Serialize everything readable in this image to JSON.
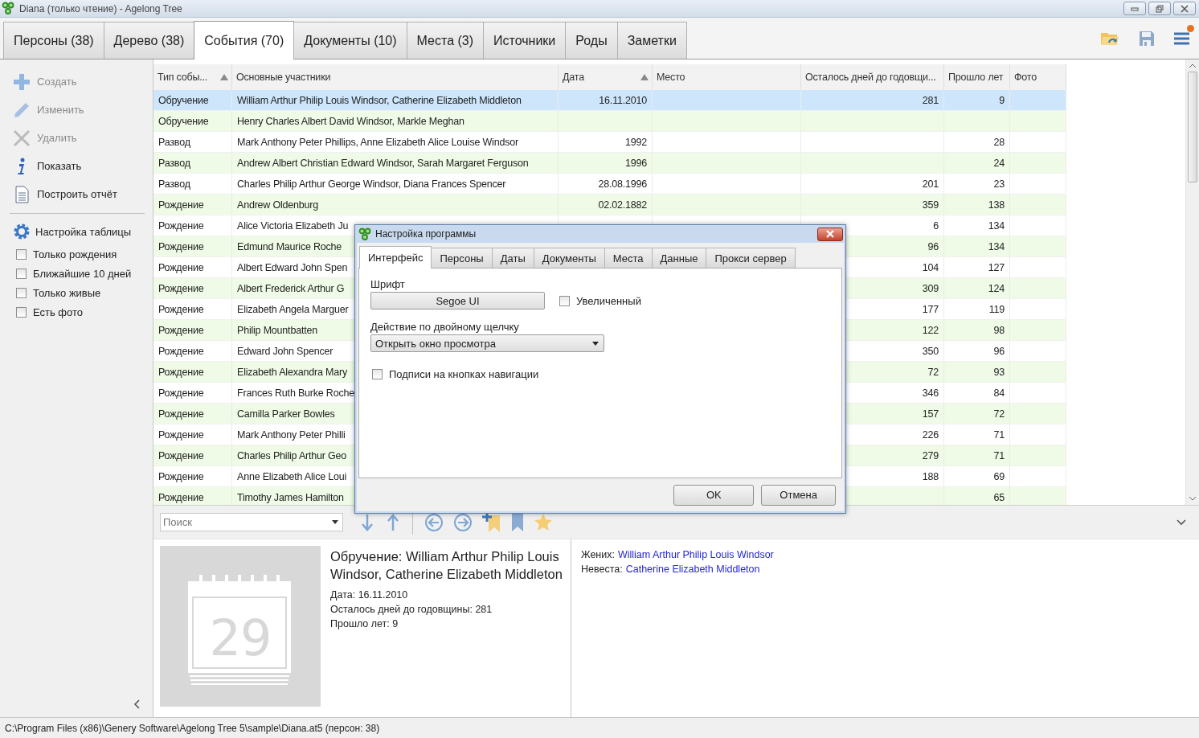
{
  "window": {
    "title": "Diana (только чтение) - Agelong Tree"
  },
  "tabs": [
    {
      "label": "Персоны (38)",
      "selected": false
    },
    {
      "label": "Дерево (38)",
      "selected": false
    },
    {
      "label": "События (70)",
      "selected": true
    },
    {
      "label": "Документы (10)",
      "selected": false
    },
    {
      "label": "Места (3)",
      "selected": false
    },
    {
      "label": "Источники",
      "selected": false
    },
    {
      "label": "Роды",
      "selected": false
    },
    {
      "label": "Заметки",
      "selected": false
    }
  ],
  "sidebar": {
    "actions": [
      {
        "label": "Создать",
        "disabled": true
      },
      {
        "label": "Изменить",
        "disabled": true
      },
      {
        "label": "Удалить",
        "disabled": true
      },
      {
        "label": "Показать",
        "disabled": false
      },
      {
        "label": "Построить отчёт",
        "disabled": false
      }
    ],
    "table_settings": "Настройка таблицы",
    "filters": [
      {
        "label": "Только рождения",
        "checked": false
      },
      {
        "label": "Ближайшие 10 дней",
        "checked": false
      },
      {
        "label": "Только живые",
        "checked": false
      },
      {
        "label": "Есть фото",
        "checked": false
      }
    ]
  },
  "table": {
    "columns": [
      {
        "label": "Тип собы...",
        "sorted": true
      },
      {
        "label": "Основные участники",
        "sorted": false
      },
      {
        "label": "Дата",
        "sorted": true
      },
      {
        "label": "Место",
        "sorted": false
      },
      {
        "label": "Осталось дней до годовщи...",
        "sorted": false
      },
      {
        "label": "Прошло лет",
        "sorted": false
      },
      {
        "label": "Фото",
        "sorted": false
      }
    ],
    "rows": [
      {
        "type": "Обручение",
        "participants": "William Arthur Philip Louis Windsor, Catherine Elizabeth Middleton",
        "date": "16.11.2010",
        "days_left": "281",
        "years": "9",
        "selected": true
      },
      {
        "type": "Обручение",
        "participants": "Henry Charles Albert David Windsor, Markle Meghan",
        "selected": false
      },
      {
        "type": "Развод",
        "participants": "Mark Anthony Peter Phillips, Anne Elizabeth Alice Louise Windsor",
        "date": "1992",
        "years": "28",
        "selected": false
      },
      {
        "type": "Развод",
        "participants": "Andrew Albert Christian Edward Windsor, Sarah Margaret Ferguson",
        "date": "1996",
        "years": "24",
        "selected": false
      },
      {
        "type": "Развод",
        "participants": "Charles Philip Arthur George Windsor, Diana Frances Spencer",
        "date": "28.08.1996",
        "days_left": "201",
        "years": "23",
        "selected": false
      },
      {
        "type": "Рождение",
        "participants": "Andrew Oldenburg",
        "date": "02.02.1882",
        "days_left": "359",
        "years": "138",
        "selected": false
      },
      {
        "type": "Рождение",
        "participants": "Alice Victoria Elizabeth Ju",
        "days_left": "6",
        "years": "134",
        "selected": false
      },
      {
        "type": "Рождение",
        "participants": "Edmund Maurice Roche",
        "days_left": "96",
        "years": "134",
        "selected": false
      },
      {
        "type": "Рождение",
        "participants": "Albert Edward John Spen",
        "days_left": "104",
        "years": "127",
        "selected": false
      },
      {
        "type": "Рождение",
        "participants": "Albert Frederick Arthur G",
        "days_left": "309",
        "years": "124",
        "selected": false
      },
      {
        "type": "Рождение",
        "participants": "Elizabeth Angela Marguer",
        "days_left": "177",
        "years": "119",
        "selected": false
      },
      {
        "type": "Рождение",
        "participants": "Philip Mountbatten",
        "days_left": "122",
        "years": "98",
        "selected": false
      },
      {
        "type": "Рождение",
        "participants": "Edward John Spencer",
        "days_left": "350",
        "years": "96",
        "selected": false
      },
      {
        "type": "Рождение",
        "participants": "Elizabeth Alexandra Mary",
        "days_left": "72",
        "years": "93",
        "selected": false
      },
      {
        "type": "Рождение",
        "participants": "Frances Ruth Burke Roche",
        "days_left": "346",
        "years": "84",
        "selected": false
      },
      {
        "type": "Рождение",
        "participants": "Camilla Parker Bowles",
        "days_left": "157",
        "years": "72",
        "selected": false
      },
      {
        "type": "Рождение",
        "participants": "Mark Anthony Peter Philli",
        "days_left": "226",
        "years": "71",
        "selected": false
      },
      {
        "type": "Рождение",
        "participants": "Charles Philip Arthur Geo",
        "days_left": "279",
        "years": "71",
        "selected": false
      },
      {
        "type": "Рождение",
        "participants": "Anne Elizabeth Alice Loui",
        "days_left": "188",
        "years": "69",
        "selected": false
      },
      {
        "type": "Рождение",
        "participants": "Timothy James Hamilton",
        "years": "65",
        "selected": false
      }
    ]
  },
  "toolbar": {
    "search": {
      "placeholder": "Поиск"
    }
  },
  "details": {
    "calendar_day": "29",
    "title": "Обручение: William Arthur Philip Louis Windsor, Catherine Elizabeth Middleton",
    "lines": [
      "Дата: 16.11.2010",
      "Осталось дней до годовщины: 281",
      "Прошло лет: 9"
    ],
    "relations": [
      {
        "label": "Жених:",
        "person": "William Arthur Philip Louis Windsor"
      },
      {
        "label": "Невеста:",
        "person": "Catherine Elizabeth Middleton"
      }
    ]
  },
  "status_bar": "C:\\Program Files (x86)\\Genery Software\\Agelong Tree 5\\sample\\Diana.at5 (персон: 38)",
  "dialog": {
    "title": "Настройка программы",
    "tabs": [
      {
        "label": "Интерфейс",
        "selected": true
      },
      {
        "label": "Персоны",
        "selected": false
      },
      {
        "label": "Даты",
        "selected": false
      },
      {
        "label": "Документы",
        "selected": false
      },
      {
        "label": "Места",
        "selected": false
      },
      {
        "label": "Данные",
        "selected": false
      },
      {
        "label": "Прокси сервер",
        "selected": false
      }
    ],
    "font_label": "Шрифт",
    "font_button": "Segoe UI",
    "enlarged": {
      "label": "Увеличенный",
      "checked": false
    },
    "double_click_label": "Действие по двойному щелчку",
    "double_click_select": {
      "value": "Открыть окно просмотра"
    },
    "nav_captions": {
      "label": "Подписи на кнопках навигации",
      "checked": false
    },
    "buttons": [
      "OK",
      "Отмена"
    ]
  }
}
